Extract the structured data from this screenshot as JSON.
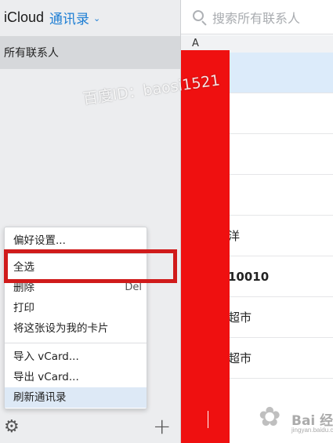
{
  "sidebar": {
    "brand": "iCloud",
    "app_title": "通讯录",
    "group": "所有联系人"
  },
  "menu": {
    "items": [
      {
        "label": "偏好设置..."
      },
      {
        "label": "全选"
      },
      {
        "label": "删除",
        "shortcut": "Del"
      },
      {
        "label": "打印"
      },
      {
        "label": "将这张设为我的卡片"
      },
      {
        "label": "导入 vCard..."
      },
      {
        "label": "导出 vCard..."
      },
      {
        "label": "刷新通讯录"
      }
    ]
  },
  "search": {
    "placeholder": "搜索所有联系人"
  },
  "list": {
    "section": "A",
    "rows": [
      {
        "text": ""
      },
      {
        "text": ""
      },
      {
        "text": ""
      },
      {
        "text": ""
      },
      {
        "text": "洋"
      },
      {
        "text": "10010"
      },
      {
        "text": "超市"
      },
      {
        "text": "超市"
      }
    ]
  },
  "watermark": {
    "text": "百度ID：baosi1521",
    "logo_text": "Bai 经验",
    "logo_sub": "jingyan.baidu.com"
  },
  "colors": {
    "accent": "#1d7ed4",
    "highlight_frame": "#d01b1b",
    "redaction": "#ef1010",
    "selected_row": "#dcebfa"
  }
}
